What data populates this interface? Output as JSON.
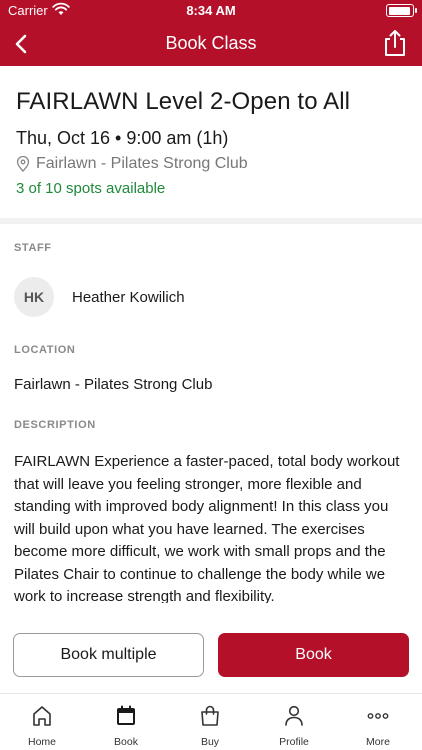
{
  "status_bar": {
    "carrier": "Carrier",
    "time": "8:34 AM"
  },
  "nav": {
    "title": "Book Class",
    "back_icon": "chevron-left-icon",
    "share_icon": "share-icon"
  },
  "class": {
    "title": "FAIRLAWN Level 2-Open to All",
    "datetime": "Thu, Oct 16 • 9:00 am (1h)",
    "location": "Fairlawn - Pilates Strong Club",
    "availability": "3 of 10 spots available"
  },
  "staff": {
    "label": "STAFF",
    "initials": "HK",
    "name": "Heather Kowilich"
  },
  "location_section": {
    "label": "LOCATION",
    "value": "Fairlawn - Pilates Strong Club"
  },
  "description": {
    "label": "DESCRIPTION",
    "text": "FAIRLAWN Experience a faster-paced, total body workout that will leave you feeling stronger, more flexible and standing with improved body alignment! In this class you will build upon what you have learned. The exercises become more difficult, we work with small props and the Pilates Chair to continue to challenge the body while we work to increase strength and flexibility."
  },
  "actions": {
    "book_multiple": "Book multiple",
    "book": "Book"
  },
  "tabs": [
    {
      "label": "Home",
      "icon": "home-icon"
    },
    {
      "label": "Book",
      "icon": "calendar-icon"
    },
    {
      "label": "Buy",
      "icon": "shopping-bag-icon"
    },
    {
      "label": "Profile",
      "icon": "person-icon"
    },
    {
      "label": "More",
      "icon": "more-dots-icon"
    }
  ],
  "colors": {
    "brand": "#b5102a",
    "availability": "#1e8a3a",
    "label": "#8a8a8a"
  }
}
